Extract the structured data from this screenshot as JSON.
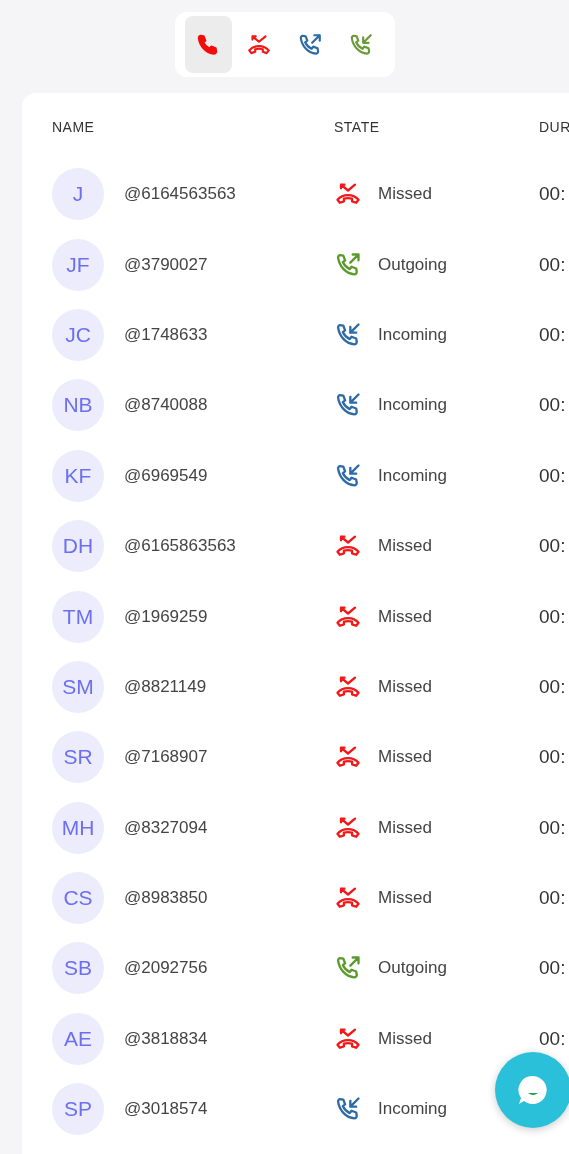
{
  "filters": [
    {
      "kind": "all",
      "selected": true
    },
    {
      "kind": "missed",
      "selected": false
    },
    {
      "kind": "outgoing",
      "selected": false
    },
    {
      "kind": "incoming",
      "selected": false
    }
  ],
  "table": {
    "columns": [
      "NAME",
      "STATE",
      "DUR"
    ],
    "rows": [
      {
        "initials": "J",
        "handle": "@6164563563",
        "kind": "missed",
        "state": "Missed",
        "duration": "00:"
      },
      {
        "initials": "JF",
        "handle": "@3790027",
        "kind": "outgoing",
        "state": "Outgoing",
        "duration": "00:"
      },
      {
        "initials": "JC",
        "handle": "@1748633",
        "kind": "incoming",
        "state": "Incoming",
        "duration": "00:"
      },
      {
        "initials": "NB",
        "handle": "@8740088",
        "kind": "incoming",
        "state": "Incoming",
        "duration": "00:"
      },
      {
        "initials": "KF",
        "handle": "@6969549",
        "kind": "incoming",
        "state": "Incoming",
        "duration": "00:"
      },
      {
        "initials": "DH",
        "handle": "@6165863563",
        "kind": "missed",
        "state": "Missed",
        "duration": "00:"
      },
      {
        "initials": "TM",
        "handle": "@1969259",
        "kind": "missed",
        "state": "Missed",
        "duration": "00:"
      },
      {
        "initials": "SM",
        "handle": "@8821149",
        "kind": "missed",
        "state": "Missed",
        "duration": "00:"
      },
      {
        "initials": "SR",
        "handle": "@7168907",
        "kind": "missed",
        "state": "Missed",
        "duration": "00:"
      },
      {
        "initials": "MH",
        "handle": "@8327094",
        "kind": "missed",
        "state": "Missed",
        "duration": "00:"
      },
      {
        "initials": "CS",
        "handle": "@8983850",
        "kind": "missed",
        "state": "Missed",
        "duration": "00:"
      },
      {
        "initials": "SB",
        "handle": "@2092756",
        "kind": "outgoing",
        "state": "Outgoing",
        "duration": "00:"
      },
      {
        "initials": "AE",
        "handle": "@3818834",
        "kind": "missed",
        "state": "Missed",
        "duration": "00:"
      },
      {
        "initials": "SP",
        "handle": "@3018574",
        "kind": "incoming",
        "state": "Incoming"
      }
    ]
  }
}
